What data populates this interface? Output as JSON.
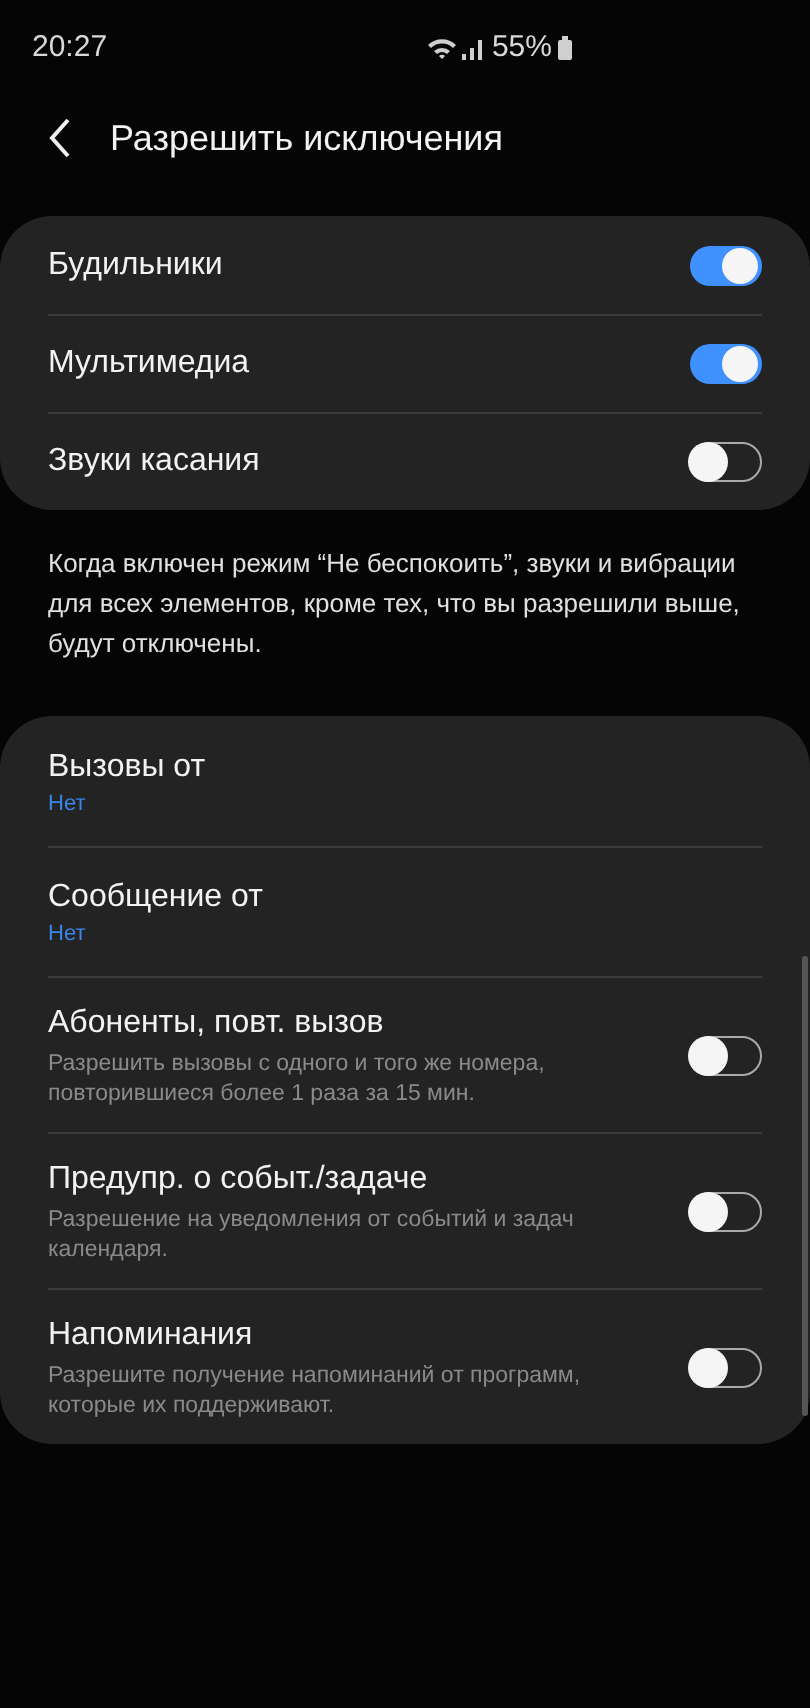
{
  "status_bar": {
    "time": "20:27",
    "battery": "55%"
  },
  "header": {
    "title": "Разрешить исключения"
  },
  "main_toggles": [
    {
      "label": "Будильники",
      "on": true
    },
    {
      "label": "Мультимедиа",
      "on": true
    },
    {
      "label": "Звуки касания",
      "on": false
    }
  ],
  "note": "Когда включен режим “Не беспокоить”, звуки и вибрации для всех элементов, кроме тех, что вы разрешили выше, будут отключены.",
  "exceptions": [
    {
      "kind": "select",
      "title": "Вызовы от",
      "value": "Нет"
    },
    {
      "kind": "select",
      "title": "Сообщение от",
      "value": "Нет"
    },
    {
      "kind": "toggle",
      "title": "Абоненты, повт. вызов",
      "description": "Разрешить вызовы с одного и того же номера, повторившиеся более 1 раза за 15 мин.",
      "on": false
    },
    {
      "kind": "toggle",
      "title": "Предупр. о событ./задаче",
      "description": "Разрешение на уведомления от событий и задач календаря.",
      "on": false
    },
    {
      "kind": "toggle",
      "title": "Напоминания",
      "description": "Разрешите получение напоминаний от программ, которые их поддерживают.",
      "on": false
    }
  ]
}
